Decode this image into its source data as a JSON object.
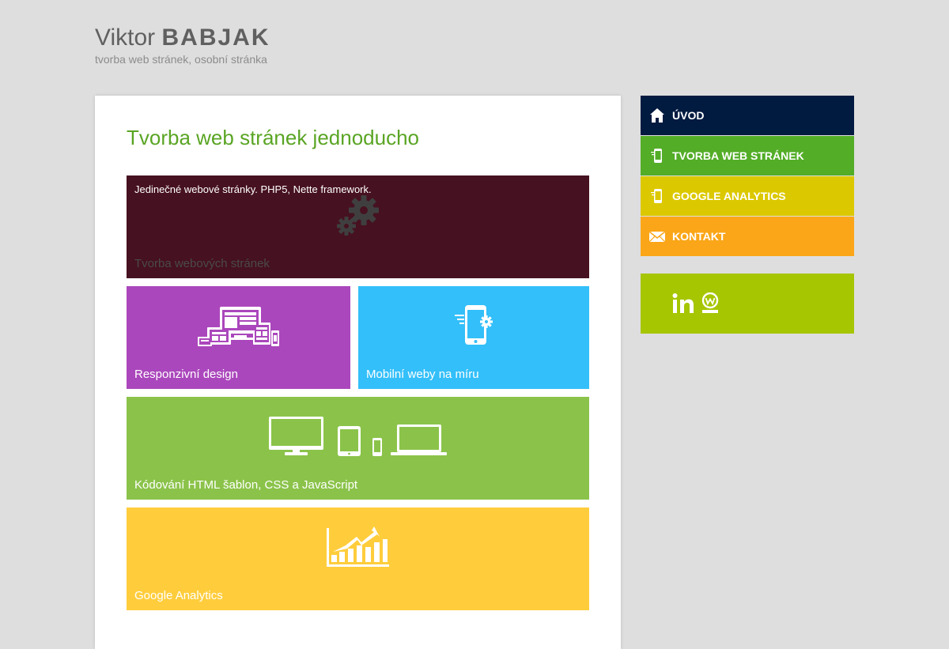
{
  "header": {
    "first_name": "Viktor",
    "last_name": "BABJAK",
    "tagline": "tvorba web stránek, osobní stránka"
  },
  "main": {
    "heading": "Tvorba web stránek jednoducho",
    "tiles": [
      {
        "label": "Tvorba webových stránek",
        "description": "Jedinečné webové stránky. PHP5, Nette framework.",
        "color": "#461120",
        "icon": "gears-icon"
      },
      {
        "label": "Responzivní design",
        "color": "#ab47bc",
        "icon": "responsive-devices-icon"
      },
      {
        "label": "Mobilní weby na míru",
        "color": "#33bff9",
        "icon": "mobile-settings-icon"
      },
      {
        "label": "Kódování HTML šablon, CSS a JavaScript",
        "color": "#8bc34a",
        "icon": "devices-icon"
      },
      {
        "label": "Google Analytics",
        "color": "#ffcd3c",
        "icon": "growth-chart-icon"
      }
    ]
  },
  "nav": {
    "items": [
      {
        "label": "ÚVOD",
        "color": "#001a40",
        "icon": "home-icon"
      },
      {
        "label": "TVORBA WEB STRÁNEK",
        "color": "#53ad27",
        "icon": "mobile-icon"
      },
      {
        "label": "GOOGLE ANALYTICS",
        "color": "#dcc800",
        "icon": "mobile-icon"
      },
      {
        "label": "KONTAKT",
        "color": "#fba618",
        "icon": "envelope-icon"
      }
    ]
  },
  "social": {
    "color": "#a5c600",
    "icons": [
      "linkedin-icon",
      "wedos-icon"
    ]
  },
  "colors": {
    "background": "#dedede",
    "heading": "#5aa524",
    "title": "#606060"
  }
}
